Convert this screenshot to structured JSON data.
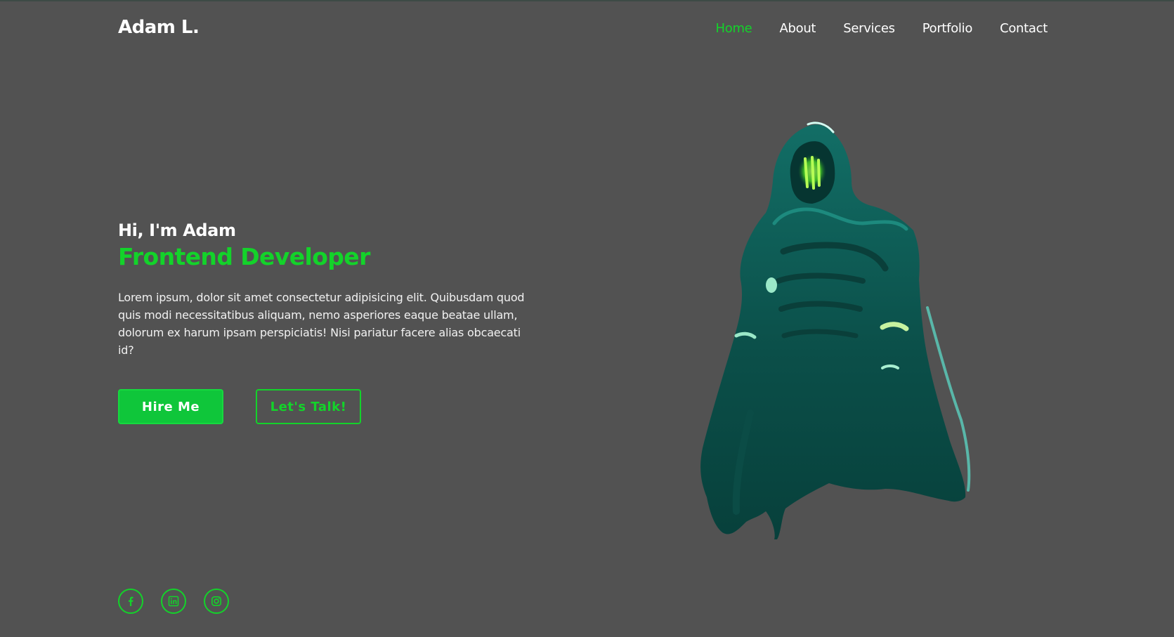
{
  "brand": {
    "name": "Adam L."
  },
  "nav": {
    "items": [
      {
        "label": "Home",
        "active": true
      },
      {
        "label": "About",
        "active": false
      },
      {
        "label": "Services",
        "active": false
      },
      {
        "label": "Portfolio",
        "active": false
      },
      {
        "label": "Contact",
        "active": false
      }
    ]
  },
  "hero": {
    "greeting": "Hi, I'm Adam",
    "role": "Frontend Developer",
    "description": "Lorem ipsum, dolor sit amet consectetur adipisicing elit. Quibusdam quod quis modi necessitatibus aliquam, nemo asperiores eaque beatae ullam, dolorum ex harum ipsam perspiciatis! Nisi pariatur facere alias obcaecati id?",
    "primary_button": "Hire Me",
    "secondary_button": "Let's Talk!"
  },
  "social": [
    {
      "icon": "facebook-icon"
    },
    {
      "icon": "linkedin-icon"
    },
    {
      "icon": "instagram-icon"
    }
  ],
  "image": {
    "subject": "hooded-figure-illustration"
  },
  "colors": {
    "background": "#525252",
    "accent": "#13d32a",
    "button_fill": "#0fc63a",
    "text": "#ffffff",
    "figure": "#0e5e55"
  }
}
